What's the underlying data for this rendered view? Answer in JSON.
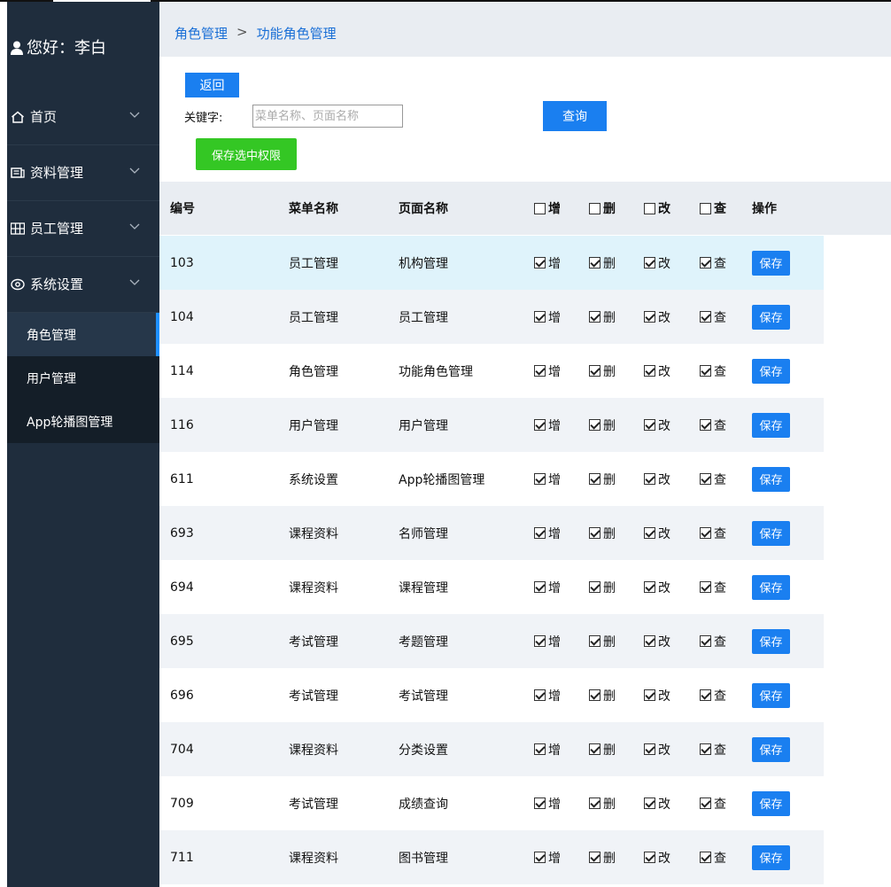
{
  "sidebar": {
    "greeting": "您好：李白",
    "menu": [
      {
        "label": "首页",
        "icon": "home-icon"
      },
      {
        "label": "资料管理",
        "icon": "document-icon"
      },
      {
        "label": "员工管理",
        "icon": "staff-icon"
      },
      {
        "label": "系统设置",
        "icon": "settings-icon"
      }
    ],
    "submenu": [
      {
        "label": "角色管理",
        "active": true
      },
      {
        "label": "用户管理",
        "active": false
      },
      {
        "label": "App轮播图管理",
        "active": false
      }
    ]
  },
  "breadcrumb": {
    "parent": "角色管理",
    "separator": ">",
    "current": "功能角色管理"
  },
  "toolbar": {
    "back_label": "返回",
    "keyword_label": "关键字:",
    "keyword_placeholder": "菜单名称、页面名称",
    "keyword_value": "",
    "query_label": "查询",
    "save_selected_label": "保存选中权限"
  },
  "table": {
    "headers": {
      "id": "编号",
      "menu": "菜单名称",
      "page": "页面名称",
      "add": "增",
      "del": "删",
      "mod": "改",
      "view": "查",
      "op": "操作"
    },
    "header_checks": {
      "add": false,
      "del": false,
      "mod": false,
      "view": false
    },
    "perm_labels": {
      "add": "增",
      "del": "删",
      "mod": "改",
      "view": "查"
    },
    "save_label": "保存",
    "rows": [
      {
        "id": "103",
        "menu": "员工管理",
        "page": "机构管理",
        "add": true,
        "del": true,
        "mod": true,
        "view": true
      },
      {
        "id": "104",
        "menu": "员工管理",
        "page": "员工管理",
        "add": true,
        "del": true,
        "mod": true,
        "view": true
      },
      {
        "id": "114",
        "menu": "角色管理",
        "page": "功能角色管理",
        "add": true,
        "del": true,
        "mod": true,
        "view": true
      },
      {
        "id": "116",
        "menu": "用户管理",
        "page": "用户管理",
        "add": true,
        "del": true,
        "mod": true,
        "view": true
      },
      {
        "id": "611",
        "menu": "系统设置",
        "page": "App轮播图管理",
        "add": true,
        "del": true,
        "mod": true,
        "view": true
      },
      {
        "id": "693",
        "menu": "课程资料",
        "page": "名师管理",
        "add": true,
        "del": true,
        "mod": true,
        "view": true
      },
      {
        "id": "694",
        "menu": "课程资料",
        "page": "课程管理",
        "add": true,
        "del": true,
        "mod": true,
        "view": true
      },
      {
        "id": "695",
        "menu": "考试管理",
        "page": "考题管理",
        "add": true,
        "del": true,
        "mod": true,
        "view": true
      },
      {
        "id": "696",
        "menu": "考试管理",
        "page": "考试管理",
        "add": true,
        "del": true,
        "mod": true,
        "view": true
      },
      {
        "id": "704",
        "menu": "课程资料",
        "page": "分类设置",
        "add": true,
        "del": true,
        "mod": true,
        "view": true
      },
      {
        "id": "709",
        "menu": "考试管理",
        "page": "成绩查询",
        "add": true,
        "del": true,
        "mod": true,
        "view": true
      },
      {
        "id": "711",
        "menu": "课程资料",
        "page": "图书管理",
        "add": true,
        "del": true,
        "mod": true,
        "view": true
      }
    ]
  },
  "colors": {
    "sidebar_bg": "#1f2d3d",
    "primary": "#1a7ff0",
    "success": "#34c724",
    "highlight_row": "#dff3fb"
  }
}
